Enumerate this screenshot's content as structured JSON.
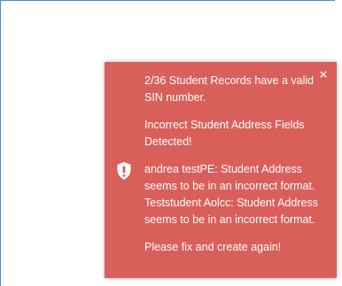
{
  "toast": {
    "close_symbol": "×",
    "icon": "shield-exclamation-icon",
    "messages": [
      "2/36 Student Records have a valid SIN number.",
      "Incorrect Student Address Fields Detected!",
      "andrea testPE: Student Address seems to be in an incorrect format. Teststudent Aolcc: Student Address seems to be in an incorrect format.",
      "Please fix and create again!"
    ],
    "colors": {
      "background": "#d9605a",
      "text": "#ffffff",
      "panel_border": "#4a89dc"
    }
  }
}
